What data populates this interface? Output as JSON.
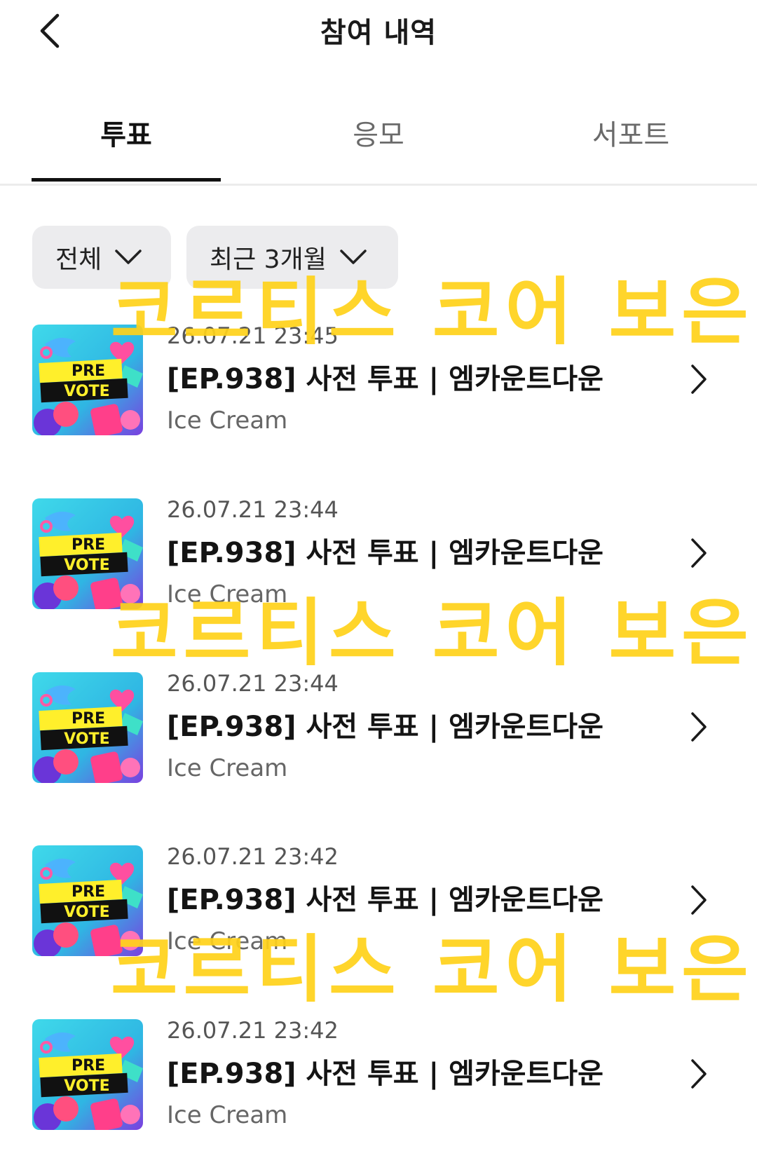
{
  "header": {
    "title": "참여 내역",
    "back_icon": "chevron-left-icon"
  },
  "tabs": [
    {
      "label": "투표",
      "active": true
    },
    {
      "label": "응모",
      "active": false
    },
    {
      "label": "서포트",
      "active": false
    }
  ],
  "filters": [
    {
      "label": "전체",
      "icon": "chevron-down-icon"
    },
    {
      "label": "최근 3개월",
      "icon": "chevron-down-icon"
    }
  ],
  "thumbnail": {
    "line1": "PRE",
    "line2": "VOTE"
  },
  "items": [
    {
      "date": "26.07.21 23:45",
      "title": "[EP.938] 사전 투표 | 엠카운트다운",
      "subtitle": "Ice Cream"
    },
    {
      "date": "26.07.21 23:44",
      "title": "[EP.938] 사전 투표 | 엠카운트다운",
      "subtitle": "Ice Cream"
    },
    {
      "date": "26.07.21 23:44",
      "title": "[EP.938] 사전 투표 | 엠카운트다운",
      "subtitle": "Ice Cream"
    },
    {
      "date": "26.07.21 23:42",
      "title": "[EP.938] 사전 투표 | 엠카운트다운",
      "subtitle": "Ice Cream"
    },
    {
      "date": "26.07.21 23:42",
      "title": "[EP.938] 사전 투표 | 엠카운트다운",
      "subtitle": "Ice Cream"
    }
  ],
  "watermark": {
    "text": "코르티스 코어 보은",
    "color": "#ffd21a"
  },
  "colors": {
    "active_tab": "#111111",
    "inactive_tab": "#6a6a6a",
    "chip_bg": "#ececee"
  }
}
